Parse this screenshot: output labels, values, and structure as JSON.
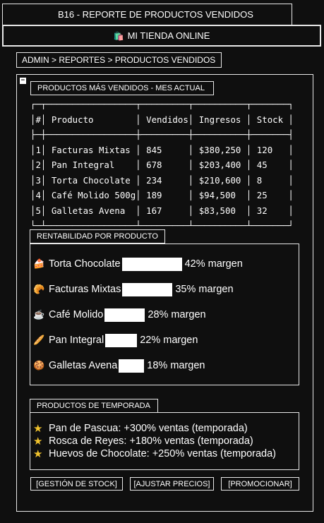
{
  "header": {
    "title": "B16 - REPORTE DE PRODUCTOS VENDIDOS",
    "store_icon": "shopping-bag-icon",
    "store_name": "MI TIENDA ONLINE",
    "breadcrumb": "ADMIN > REPORTES > PRODUCTOS VENDIDOS"
  },
  "panel": {
    "collapse_symbol": "−"
  },
  "top_products": {
    "title": "PRODUCTOS MÁS VENDIDOS - MES ACTUAL",
    "columns": [
      "#",
      "Producto",
      "Vendidos",
      "Ingresos",
      "Stock"
    ],
    "rows": [
      [
        "1",
        "Facturas Mixtas",
        "845",
        "$380,250",
        "120"
      ],
      [
        "2",
        "Pan Integral",
        "678",
        "$203,400",
        "45"
      ],
      [
        "3",
        "Torta Chocolate",
        "234",
        "$210,600",
        "8"
      ],
      [
        "4",
        "Café Molido 500g",
        "189",
        "$94,500",
        "25"
      ],
      [
        "5",
        "Galletas Avena",
        "167",
        "$83,500",
        "32"
      ]
    ]
  },
  "profitability": {
    "title": "RENTABILIDAD POR PRODUCTO",
    "items": [
      {
        "emoji": "🍰",
        "name": "Torta Chocolate",
        "margin": 0.42,
        "label": "42% margen"
      },
      {
        "emoji": "🥐",
        "name": "Facturas Mixtas",
        "margin": 0.35,
        "label": "35% margen"
      },
      {
        "emoji": "☕",
        "name": "Café Molido",
        "margin": 0.28,
        "label": "28% margen"
      },
      {
        "emoji": "🥖",
        "name": "Pan Integral",
        "margin": 0.22,
        "label": "22% margen"
      },
      {
        "emoji": "🍪",
        "name": "Galletas Avena",
        "margin": 0.18,
        "label": "18% margen"
      }
    ]
  },
  "seasonal": {
    "title": "PRODUCTOS DE TEMPORADA",
    "items": [
      "Pan de Pascua: +300% ventas (temporada)",
      "Rosca de Reyes: +180% ventas (temporada)",
      "Huevos de Chocolate: +250% ventas (temporada)"
    ]
  },
  "actions": {
    "stock": "[GESTIÓN DE STOCK]",
    "prices": "[AJUSTAR PRECIOS]",
    "promote": "[PROMOCIONAR]"
  }
}
